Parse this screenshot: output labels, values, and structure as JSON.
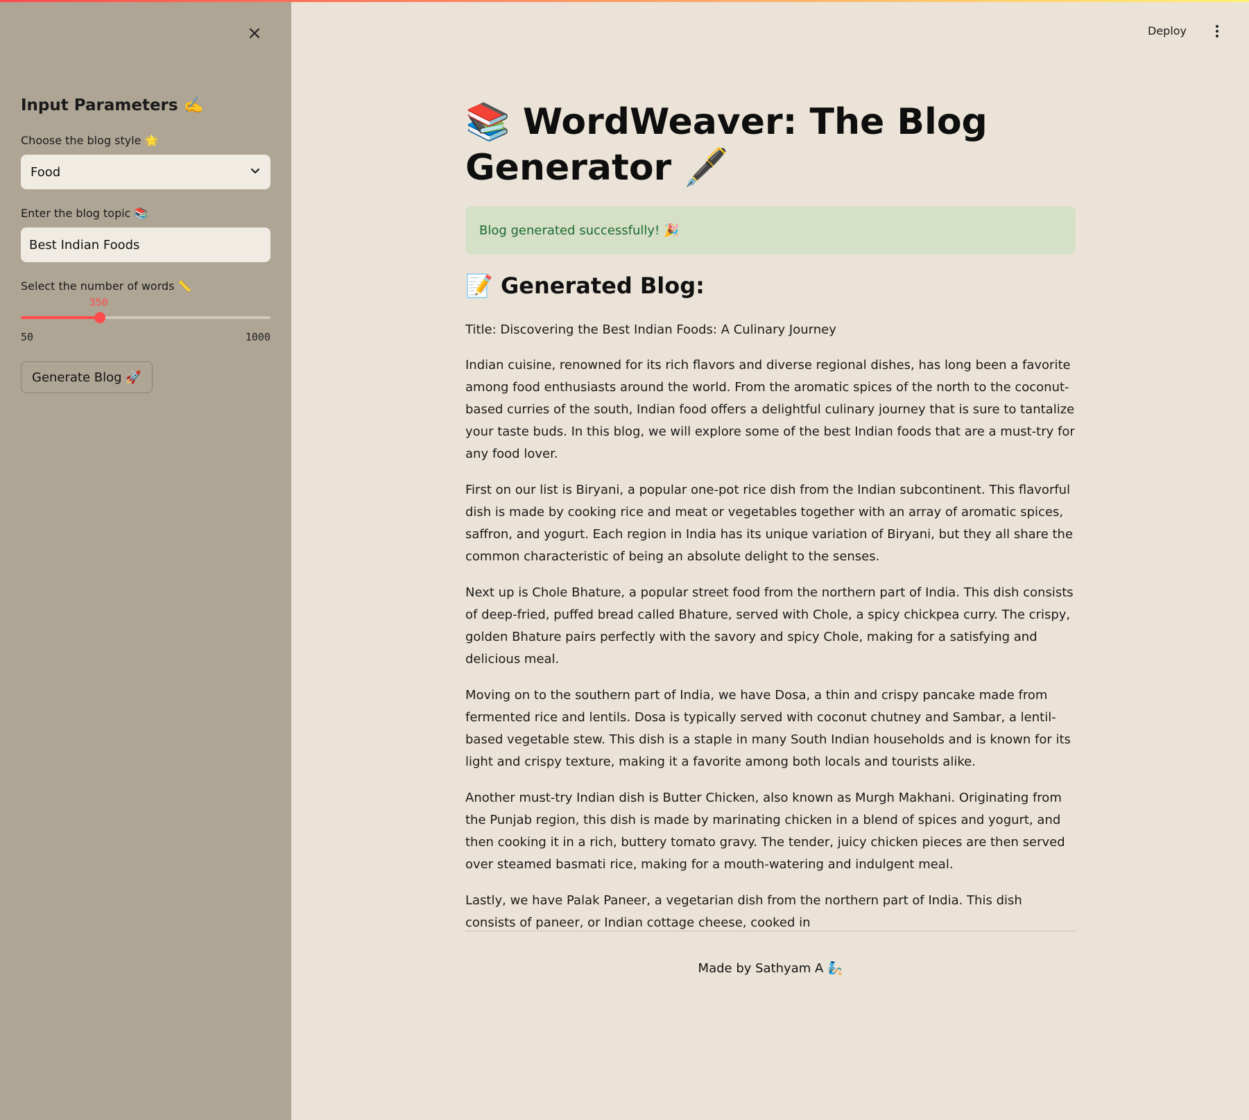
{
  "sidebar": {
    "close_icon": "×",
    "heading": "Input Parameters ✍️",
    "style_label": "Choose the blog style 🌟",
    "style_value": "Food",
    "topic_label": "Enter the blog topic 📚",
    "topic_value": "Best Indian Foods",
    "words_label": "Select the number of words 📏",
    "words_value": "350",
    "words_min": "50",
    "words_max": "1000",
    "words_fraction": 0.3158,
    "generate_label": "Generate Blog 🚀"
  },
  "header": {
    "deploy_label": "Deploy"
  },
  "main": {
    "title": "📚 WordWeaver: The Blog Generator 🖋️",
    "success_message": "Blog generated successfully! 🎉",
    "blog_heading": "📝 Generated Blog:",
    "blog_title": "Title: Discovering the Best Indian Foods: A Culinary Journey",
    "paragraphs": [
      "Indian cuisine, renowned for its rich flavors and diverse regional dishes, has long been a favorite among food enthusiasts around the world. From the aromatic spices of the north to the coconut-based curries of the south, Indian food offers a delightful culinary journey that is sure to tantalize your taste buds. In this blog, we will explore some of the best Indian foods that are a must-try for any food lover.",
      "First on our list is Biryani, a popular one-pot rice dish from the Indian subcontinent. This flavorful dish is made by cooking rice and meat or vegetables together with an array of aromatic spices, saffron, and yogurt. Each region in India has its unique variation of Biryani, but they all share the common characteristic of being an absolute delight to the senses.",
      "Next up is Chole Bhature, a popular street food from the northern part of India. This dish consists of deep-fried, puffed bread called Bhature, served with Chole, a spicy chickpea curry. The crispy, golden Bhature pairs perfectly with the savory and spicy Chole, making for a satisfying and delicious meal.",
      "Moving on to the southern part of India, we have Dosa, a thin and crispy pancake made from fermented rice and lentils. Dosa is typically served with coconut chutney and Sambar, a lentil-based vegetable stew. This dish is a staple in many South Indian households and is known for its light and crispy texture, making it a favorite among both locals and tourists alike.",
      "Another must-try Indian dish is Butter Chicken, also known as Murgh Makhani. Originating from the Punjab region, this dish is made by marinating chicken in a blend of spices and yogurt, and then cooking it in a rich, buttery tomato gravy. The tender, juicy chicken pieces are then served over steamed basmati rice, making for a mouth-watering and indulgent meal.",
      "Lastly, we have Palak Paneer, a vegetarian dish from the northern part of India. This dish consists of paneer, or Indian cottage cheese, cooked in"
    ],
    "footer": "Made by Sathyam A 🧞"
  },
  "colors": {
    "accent": "#ff4b4b",
    "sidebar_bg": "#aea595",
    "main_bg": "#ebe3d7",
    "success_bg": "#d6e0c7",
    "success_text": "#1b6b2f"
  },
  "icons": [
    "close-icon",
    "chevron-down-icon",
    "kebab-menu-icon"
  ]
}
